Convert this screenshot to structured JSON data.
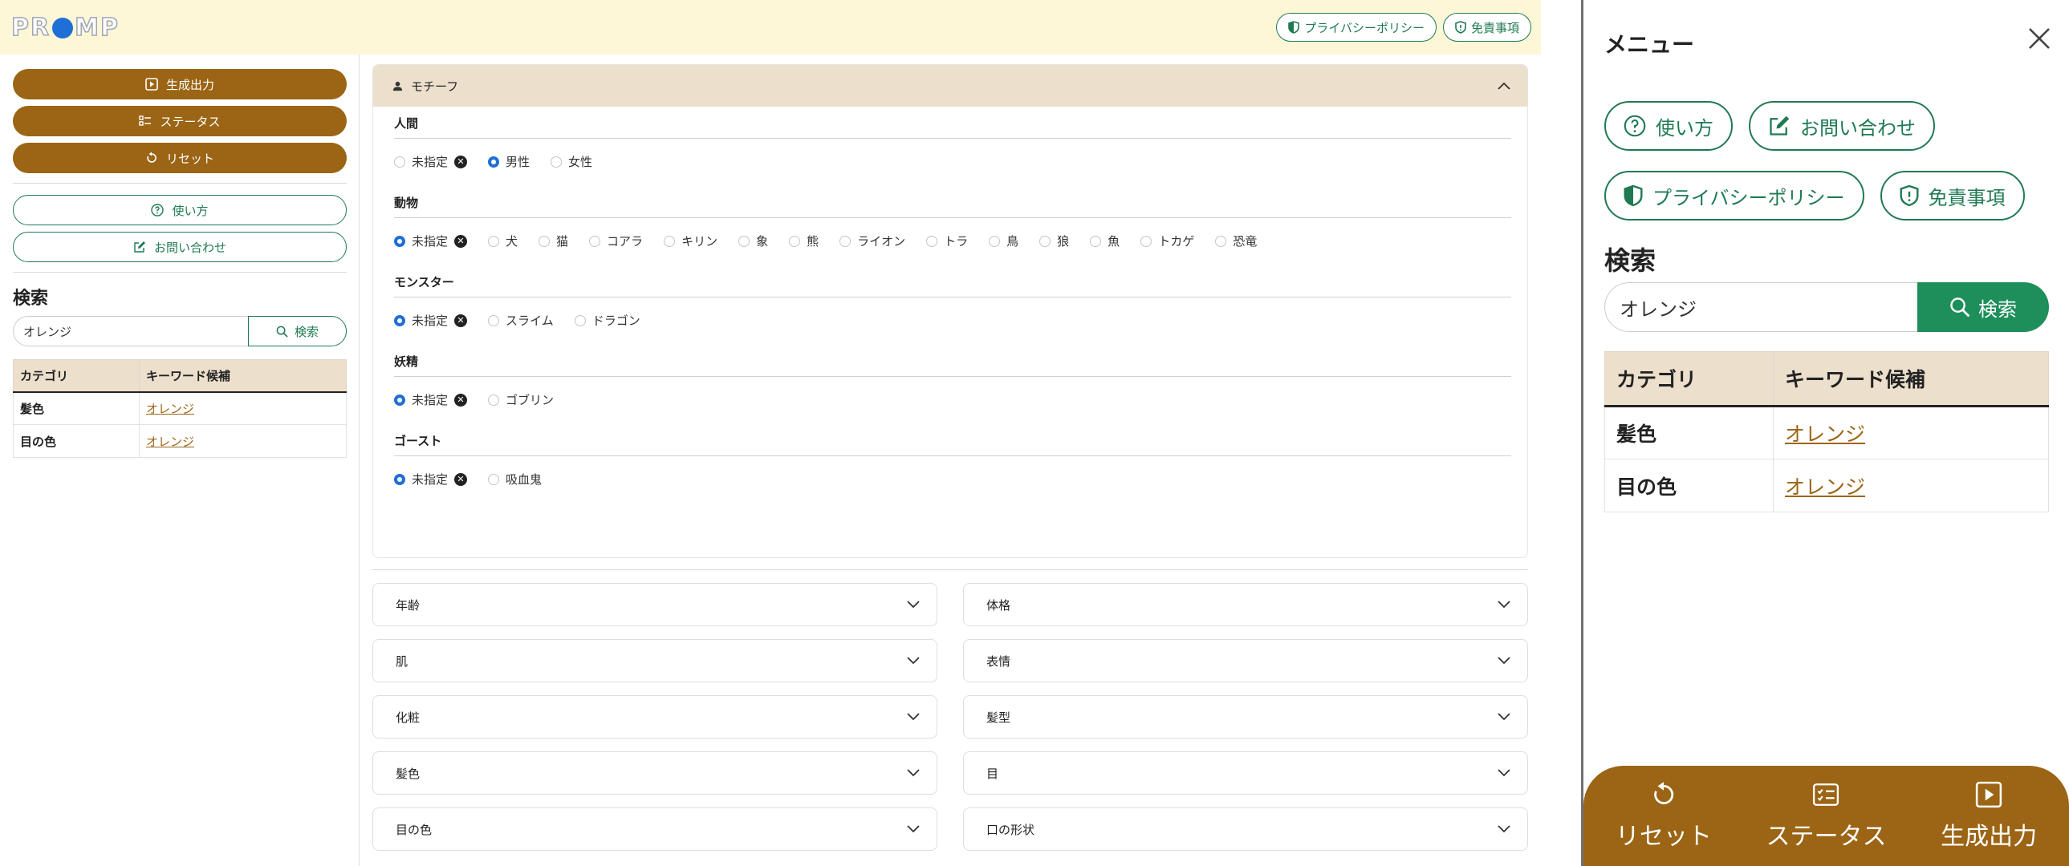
{
  "header": {
    "logo_pre": "PR",
    "logo_post": "MP",
    "privacy_label": "プライバシーポリシー",
    "disclaimer_label": "免責事項"
  },
  "sidebar": {
    "generate_label": "生成出力",
    "status_label": "ステータス",
    "reset_label": "リセット",
    "howto_label": "使い方",
    "contact_label": "お問い合わせ",
    "search_title": "検索",
    "search_value": "オレンジ",
    "search_button": "検索",
    "table_headers": [
      "カテゴリ",
      "キーワード候補"
    ],
    "rows": [
      {
        "category": "髪色",
        "keyword": "オレンジ"
      },
      {
        "category": "目の色",
        "keyword": "オレンジ"
      }
    ]
  },
  "motif": {
    "title": "モチーフ",
    "groups": [
      {
        "title": "人間",
        "options": [
          {
            "label": "未指定",
            "checked": false,
            "clear": true
          },
          {
            "label": "男性",
            "checked": true
          },
          {
            "label": "女性",
            "checked": false
          }
        ]
      },
      {
        "title": "動物",
        "options": [
          {
            "label": "未指定",
            "checked": true,
            "clear": true
          },
          {
            "label": "犬",
            "checked": false
          },
          {
            "label": "猫",
            "checked": false
          },
          {
            "label": "コアラ",
            "checked": false
          },
          {
            "label": "キリン",
            "checked": false
          },
          {
            "label": "象",
            "checked": false
          },
          {
            "label": "熊",
            "checked": false
          },
          {
            "label": "ライオン",
            "checked": false
          },
          {
            "label": "トラ",
            "checked": false
          },
          {
            "label": "鳥",
            "checked": false
          },
          {
            "label": "狼",
            "checked": false
          },
          {
            "label": "魚",
            "checked": false
          },
          {
            "label": "トカゲ",
            "checked": false
          },
          {
            "label": "恐竜",
            "checked": false
          }
        ]
      },
      {
        "title": "モンスター",
        "options": [
          {
            "label": "未指定",
            "checked": true,
            "clear": true
          },
          {
            "label": "スライム",
            "checked": false
          },
          {
            "label": "ドラゴン",
            "checked": false
          }
        ]
      },
      {
        "title": "妖精",
        "options": [
          {
            "label": "未指定",
            "checked": true,
            "clear": true
          },
          {
            "label": "ゴブリン",
            "checked": false
          }
        ]
      },
      {
        "title": "ゴースト",
        "options": [
          {
            "label": "未指定",
            "checked": true,
            "clear": true
          },
          {
            "label": "吸血鬼",
            "checked": false
          }
        ]
      }
    ]
  },
  "accordions": [
    "年齢",
    "体格",
    "肌",
    "表情",
    "化粧",
    "髪型",
    "髪色",
    "目",
    "目の色",
    "口の形状"
  ],
  "drawer": {
    "title": "メニュー",
    "howto_label": "使い方",
    "contact_label": "お問い合わせ",
    "privacy_label": "プライバシーポリシー",
    "disclaimer_label": "免責事項",
    "search_title": "検索",
    "search_value": "オレンジ",
    "search_button": "検索",
    "table_headers": [
      "カテゴリ",
      "キーワード候補"
    ],
    "rows": [
      {
        "category": "髪色",
        "keyword": "オレンジ"
      },
      {
        "category": "目の色",
        "keyword": "オレンジ"
      }
    ],
    "bottom": {
      "reset": "リセット",
      "status": "ステータス",
      "generate": "生成出力"
    }
  },
  "colors": {
    "brown": "#9b6515",
    "green": "#1f7a52",
    "green_fill": "#1e8e5a",
    "header_bg": "#fdf7d8",
    "table_head": "#ecdfcc",
    "radio_on": "#1f6fd6"
  }
}
